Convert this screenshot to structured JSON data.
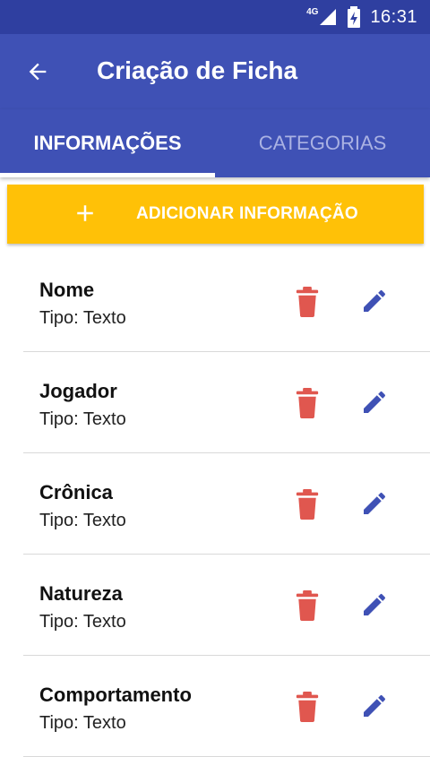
{
  "status_bar": {
    "network": "4G",
    "time": "16:31"
  },
  "app_bar": {
    "title": "Criação de Ficha"
  },
  "tabs": [
    {
      "label": "INFORMAÇÕES",
      "active": true
    },
    {
      "label": "CATEGORIAS",
      "active": false
    }
  ],
  "add_button": {
    "label": "ADICIONAR INFORMAÇÃO",
    "icon": "plus-icon"
  },
  "items": [
    {
      "name": "Nome",
      "type": "Tipo: Texto"
    },
    {
      "name": "Jogador",
      "type": "Tipo: Texto"
    },
    {
      "name": "Crônica",
      "type": "Tipo: Texto"
    },
    {
      "name": "Natureza",
      "type": "Tipo: Texto"
    },
    {
      "name": "Comportamento",
      "type": "Tipo: Texto"
    }
  ],
  "colors": {
    "status_bar": "#2f3fa0",
    "primary": "#3f51b5",
    "accent": "#ffc107",
    "delete": "#e0574f",
    "edit": "#3f51b5"
  }
}
